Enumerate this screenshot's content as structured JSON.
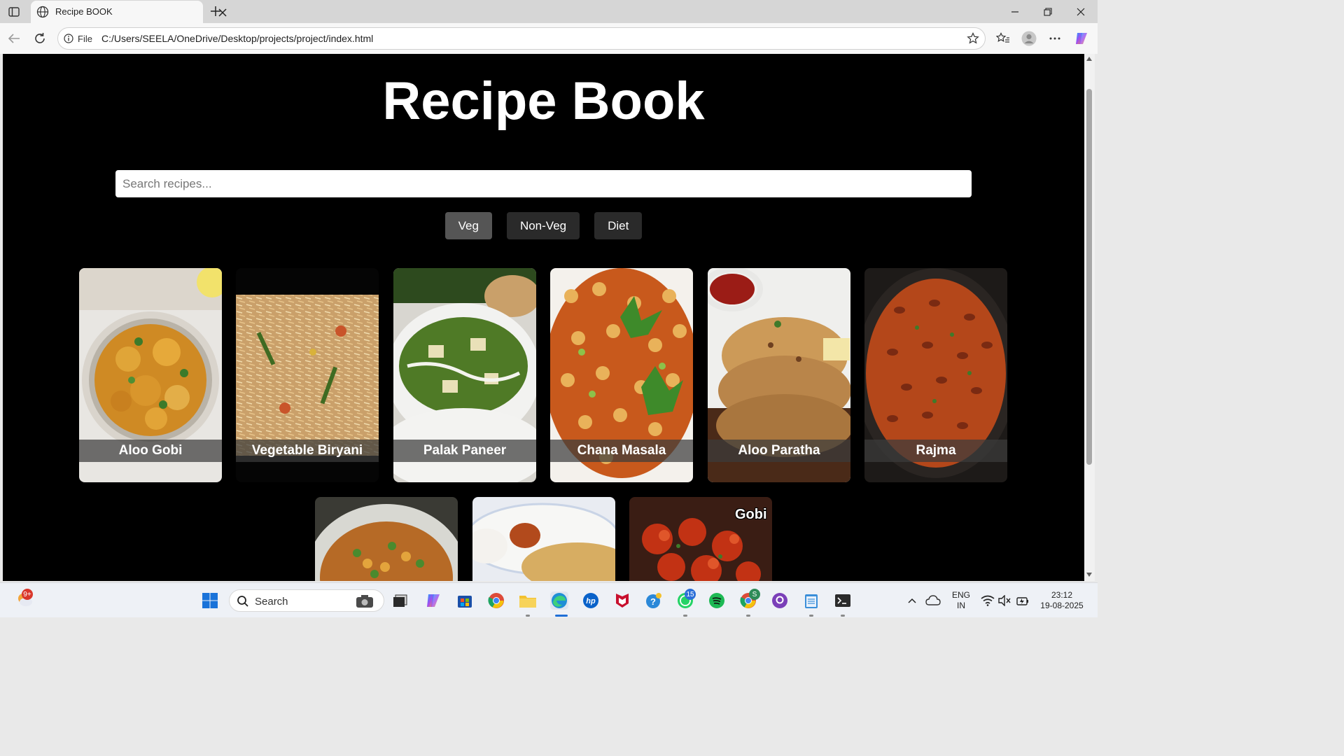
{
  "browser": {
    "tab_title": "Recipe BOOK",
    "address_prefix": "File",
    "url": "C:/Users/SEELA/OneDrive/Desktop/projects/project/index.html"
  },
  "page": {
    "title": "Recipe Book",
    "search_placeholder": "Search recipes...",
    "filters": [
      {
        "label": "Veg",
        "active": true
      },
      {
        "label": "Non-Veg",
        "active": false
      },
      {
        "label": "Diet",
        "active": false
      }
    ],
    "recipes": [
      {
        "name": "Aloo Gobi"
      },
      {
        "name": "Vegetable Biryani"
      },
      {
        "name": "Palak Paneer"
      },
      {
        "name": "Chana Masala"
      },
      {
        "name": "Aloo Paratha"
      },
      {
        "name": "Rajma"
      }
    ],
    "partial_card_text": "Gobi"
  },
  "taskbar": {
    "search_label": "Search",
    "weather_badge": "9+",
    "whatsapp_badge": "15",
    "chrome_badge": "S",
    "language": "ENG",
    "region": "IN",
    "time": "23:12",
    "date": "19-08-2025"
  },
  "colors": {
    "page_bg": "#000000",
    "active_filter": "#555555",
    "filter": "#2a2a2a",
    "caption_band": "#3c3c3c"
  }
}
